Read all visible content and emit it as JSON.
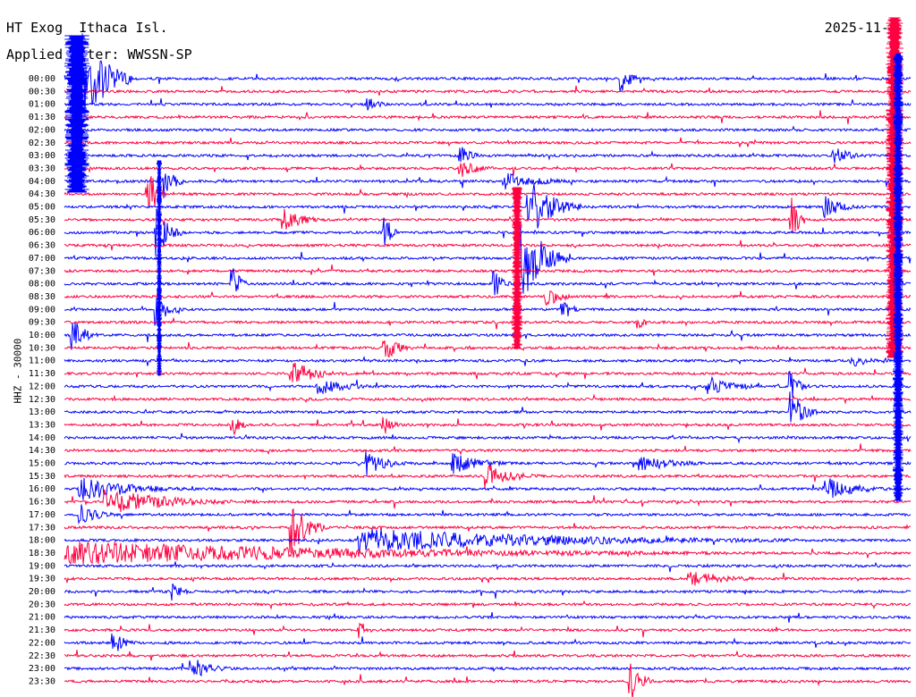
{
  "header": {
    "station": "HT Exog  Ithaca Isl.",
    "filter": "Applied  lter: WWSSN-SP",
    "date": "2025-11-"
  },
  "chart_data": {
    "type": "line",
    "title": "HT Exog  Ithaca Isl.",
    "ylabel": "HHZ - 30000",
    "xlabel": "",
    "row_labels": [
      "00:00",
      "00:30",
      "01:00",
      "01:30",
      "02:00",
      "02:30",
      "03:00",
      "03:30",
      "04:00",
      "04:30",
      "05:00",
      "05:30",
      "06:00",
      "06:30",
      "07:00",
      "07:30",
      "08:00",
      "08:30",
      "09:00",
      "09:30",
      "10:00",
      "10:30",
      "11:00",
      "11:30",
      "12:00",
      "12:30",
      "13:00",
      "13:30",
      "14:00",
      "14:30",
      "15:00",
      "15:30",
      "16:00",
      "16:30",
      "17:00",
      "17:30",
      "18:00",
      "18:30",
      "19:00",
      "19:30",
      "20:00",
      "20:30",
      "21:00",
      "21:30",
      "22:00",
      "22:30",
      "23:00",
      "23:30"
    ],
    "colors": [
      "#0000ff",
      "#ff0040"
    ],
    "events": [
      {
        "row": 0,
        "pos": 0.02,
        "amp": 60,
        "dur": 0.06
      },
      {
        "row": 0,
        "pos": 0.66,
        "amp": 18,
        "dur": 0.02
      },
      {
        "row": 2,
        "pos": 0.36,
        "amp": 8,
        "dur": 0.03
      },
      {
        "row": 6,
        "pos": 0.47,
        "amp": 10,
        "dur": 0.03
      },
      {
        "row": 6,
        "pos": 0.91,
        "amp": 10,
        "dur": 0.05
      },
      {
        "row": 7,
        "pos": 0.47,
        "amp": 10,
        "dur": 0.05
      },
      {
        "row": 8,
        "pos": 0.12,
        "amp": 25,
        "dur": 0.02
      },
      {
        "row": 8,
        "pos": 0.52,
        "amp": 10,
        "dur": 0.1
      },
      {
        "row": 9,
        "pos": 0.1,
        "amp": 30,
        "dur": 0.02
      },
      {
        "row": 10,
        "pos": 0.55,
        "amp": 35,
        "dur": 0.06
      },
      {
        "row": 10,
        "pos": 0.9,
        "amp": 12,
        "dur": 0.05
      },
      {
        "row": 11,
        "pos": 0.26,
        "amp": 12,
        "dur": 0.06
      },
      {
        "row": 11,
        "pos": 0.86,
        "amp": 25,
        "dur": 0.02
      },
      {
        "row": 12,
        "pos": 0.11,
        "amp": 30,
        "dur": 0.03
      },
      {
        "row": 12,
        "pos": 0.38,
        "amp": 22,
        "dur": 0.02
      },
      {
        "row": 14,
        "pos": 0.54,
        "amp": 50,
        "dur": 0.06
      },
      {
        "row": 16,
        "pos": 0.2,
        "amp": 18,
        "dur": 0.02
      },
      {
        "row": 16,
        "pos": 0.51,
        "amp": 14,
        "dur": 0.02
      },
      {
        "row": 17,
        "pos": 0.57,
        "amp": 12,
        "dur": 0.04
      },
      {
        "row": 18,
        "pos": 0.11,
        "amp": 20,
        "dur": 0.03
      },
      {
        "row": 18,
        "pos": 0.59,
        "amp": 14,
        "dur": 0.02
      },
      {
        "row": 19,
        "pos": 0.68,
        "amp": 8,
        "dur": 0.02
      },
      {
        "row": 20,
        "pos": 0.01,
        "amp": 20,
        "dur": 0.03
      },
      {
        "row": 21,
        "pos": 0.38,
        "amp": 14,
        "dur": 0.04
      },
      {
        "row": 22,
        "pos": 0.93,
        "amp": 8,
        "dur": 0.05
      },
      {
        "row": 23,
        "pos": 0.27,
        "amp": 14,
        "dur": 0.07
      },
      {
        "row": 24,
        "pos": 0.3,
        "amp": 10,
        "dur": 0.08
      },
      {
        "row": 24,
        "pos": 0.76,
        "amp": 12,
        "dur": 0.08
      },
      {
        "row": 24,
        "pos": 0.86,
        "amp": 18,
        "dur": 0.02
      },
      {
        "row": 26,
        "pos": 0.86,
        "amp": 25,
        "dur": 0.03
      },
      {
        "row": 27,
        "pos": 0.2,
        "amp": 12,
        "dur": 0.02
      },
      {
        "row": 27,
        "pos": 0.38,
        "amp": 10,
        "dur": 0.02
      },
      {
        "row": 30,
        "pos": 0.36,
        "amp": 14,
        "dur": 0.05
      },
      {
        "row": 30,
        "pos": 0.46,
        "amp": 12,
        "dur": 0.08
      },
      {
        "row": 30,
        "pos": 0.68,
        "amp": 10,
        "dur": 0.1
      },
      {
        "row": 31,
        "pos": 0.5,
        "amp": 14,
        "dur": 0.07
      },
      {
        "row": 32,
        "pos": 0.02,
        "amp": 14,
        "dur": 0.15
      },
      {
        "row": 32,
        "pos": 0.9,
        "amp": 14,
        "dur": 0.08
      },
      {
        "row": 33,
        "pos": 0.05,
        "amp": 14,
        "dur": 0.2
      },
      {
        "row": 34,
        "pos": 0.02,
        "amp": 12,
        "dur": 0.05
      },
      {
        "row": 35,
        "pos": 0.27,
        "amp": 30,
        "dur": 0.04
      },
      {
        "row": 36,
        "pos": 0.35,
        "amp": 14,
        "dur": 0.6
      },
      {
        "row": 37,
        "pos": 0.0,
        "amp": 14,
        "dur": 0.9
      },
      {
        "row": 39,
        "pos": 0.74,
        "amp": 10,
        "dur": 0.1
      },
      {
        "row": 40,
        "pos": 0.13,
        "amp": 12,
        "dur": 0.02
      },
      {
        "row": 43,
        "pos": 0.35,
        "amp": 10,
        "dur": 0.02
      },
      {
        "row": 44,
        "pos": 0.06,
        "amp": 12,
        "dur": 0.03
      },
      {
        "row": 46,
        "pos": 0.15,
        "amp": 14,
        "dur": 0.05
      },
      {
        "row": 47,
        "pos": 0.67,
        "amp": 22,
        "dur": 0.03
      }
    ]
  }
}
